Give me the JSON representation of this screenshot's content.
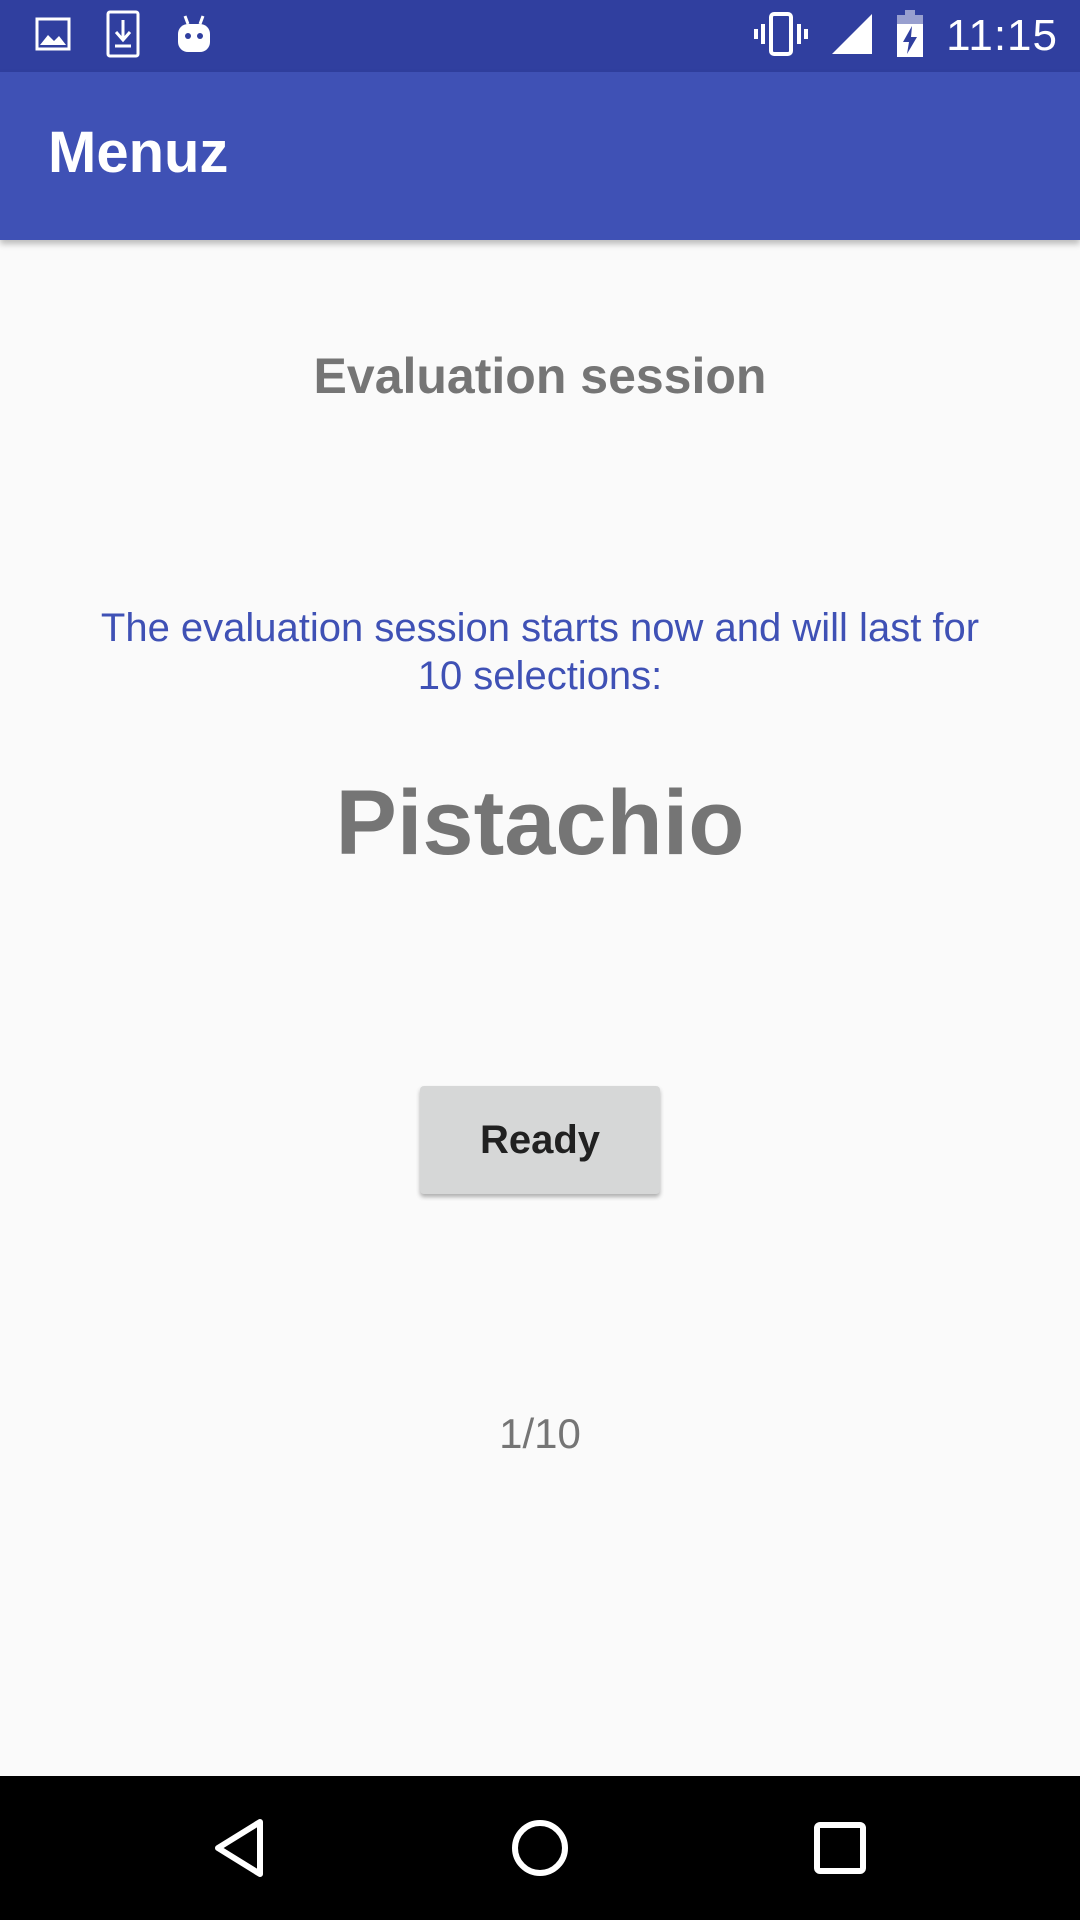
{
  "status_bar": {
    "time": "11:15",
    "left_icons": [
      "image-icon",
      "download-icon",
      "android-icon"
    ],
    "right_icons": [
      "vibrate-icon",
      "signal-icon",
      "battery-charging-icon"
    ]
  },
  "app_bar": {
    "title": "Menuz"
  },
  "main": {
    "session_title": "Evaluation session",
    "intro_text": "The evaluation session starts now and will last for 10 selections:",
    "flavor": "Pistachio",
    "ready_label": "Ready",
    "progress_label": "1/10"
  },
  "nav_bar": {
    "buttons": [
      "back-icon",
      "home-icon",
      "recents-icon"
    ]
  },
  "colors": {
    "status_bar": "#303f9f",
    "app_bar": "#3f51b5",
    "accent_text": "#3f51b5",
    "secondary_text": "#757575",
    "background": "#fafafa"
  }
}
